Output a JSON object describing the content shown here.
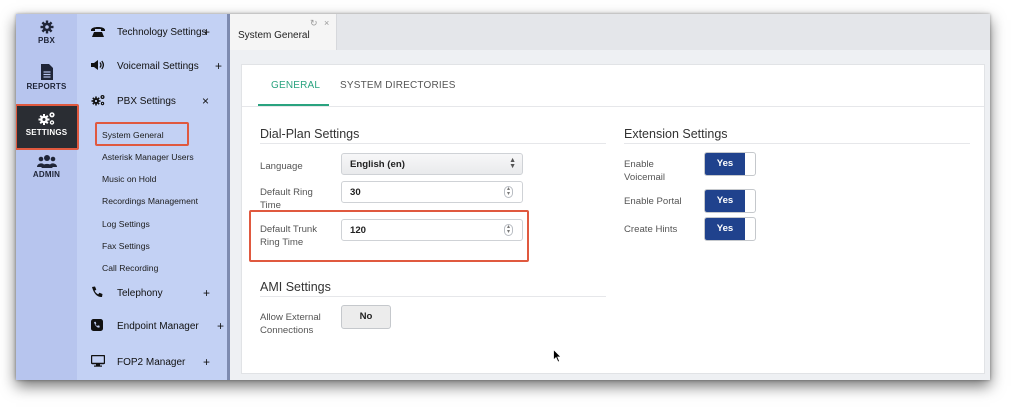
{
  "rail": {
    "items": [
      {
        "label": "PBX",
        "icon": "gear-icon"
      },
      {
        "label": "REPORTS",
        "icon": "document-icon"
      },
      {
        "label": "SETTINGS",
        "icon": "gears-icon"
      },
      {
        "label": "ADMIN",
        "icon": "users-icon"
      }
    ]
  },
  "submenu": {
    "groups": [
      {
        "label": "Technology Settings",
        "toggle": "+",
        "icon": "phone-icon"
      },
      {
        "label": "Voicemail Settings",
        "toggle": "+",
        "icon": "speaker-icon"
      },
      {
        "label": "PBX Settings",
        "toggle": "×",
        "icon": "gears-icon"
      },
      {
        "label": "Telephony",
        "toggle": "+",
        "icon": "handset-icon"
      },
      {
        "label": "Endpoint Manager",
        "toggle": "+",
        "icon": "endpoint-phone-icon"
      },
      {
        "label": "FOP2 Manager",
        "toggle": "+",
        "icon": "monitor-icon"
      }
    ],
    "links": [
      "System General",
      "Asterisk Manager Users",
      "Music on Hold",
      "Recordings Management",
      "Log Settings",
      "Fax Settings",
      "Call Recording"
    ]
  },
  "doc_tab": {
    "label": "System General",
    "controls": "↻ ×"
  },
  "tabs": [
    "GENERAL",
    "SYSTEM DIRECTORIES"
  ],
  "dialplan": {
    "title": "Dial-Plan Settings",
    "language": {
      "label": "Language",
      "value": "English (en)"
    },
    "ring_time": {
      "label": "Default Ring Time",
      "value": "30"
    },
    "trunk_ring_time": {
      "label": "Default Trunk Ring Time",
      "value": "120"
    }
  },
  "ami": {
    "title": "AMI Settings",
    "allow_external": {
      "label": "Allow External Connections",
      "value": "No"
    }
  },
  "extension": {
    "title": "Extension Settings",
    "enable_voicemail": {
      "label": "Enable Voicemail",
      "value": "Yes"
    },
    "enable_portal": {
      "label": "Enable Portal",
      "value": "Yes"
    },
    "create_hints": {
      "label": "Create Hints",
      "value": "Yes"
    }
  },
  "colors": {
    "accent": "#2aa37f",
    "toggle_on": "#20428d",
    "highlight": "#e0593f",
    "rail_bg": "#b7c5ee",
    "submenu_bg": "#c3d1f4"
  }
}
